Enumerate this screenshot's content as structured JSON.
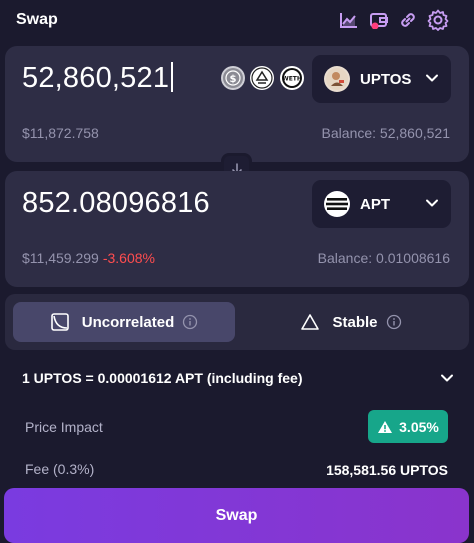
{
  "header": {
    "title": "Swap",
    "icons": [
      "chart-icon",
      "wallet-icon",
      "link-icon",
      "settings-icon"
    ]
  },
  "from": {
    "amount": "52,860,521",
    "usd_value": "$11,872.758",
    "balance": "Balance: 52,860,521",
    "token": "UPTOS",
    "quick_tokens": [
      "usdc-token-icon",
      "token-icon",
      "weth-token-icon"
    ]
  },
  "to": {
    "amount": "852.08096816",
    "usd_value": "$11,459.299",
    "change": "-3.608%",
    "balance": "Balance: 0.01008616",
    "token": "APT"
  },
  "curve": {
    "options": [
      {
        "label": "Uncorrelated",
        "active": true
      },
      {
        "label": "Stable",
        "active": false
      }
    ]
  },
  "rate": {
    "text": "1 UPTOS = 0.00001612 APT (including fee)"
  },
  "details": {
    "price_impact_label": "Price Impact",
    "price_impact_value": "3.05%",
    "fee_label": "Fee (0.3%)",
    "fee_value": "158,581.56 UPTOS"
  },
  "swap_button": "Swap",
  "colors": {
    "background": "#1b1a2e",
    "card": "#2e2d45",
    "accent": "#7a3be0",
    "impact": "#17a68a",
    "negative": "#ff4d4f",
    "icon": "#c79df2"
  }
}
